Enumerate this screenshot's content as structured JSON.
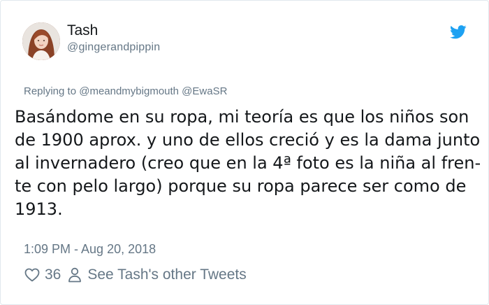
{
  "tweet": {
    "author_name": "Tash",
    "author_handle": "@gingerandpippin",
    "replying_prefix": "Replying to ",
    "replying_to": "@meandmybigmouth @EwaSR",
    "text": "Basándome en su ropa, mi teoría es que los niños son\nde 1900 aprox. y uno de ellos creció y es la dama junto\nal invernadero (creo que en la 4ª foto es la niña al fren-\nte con pelo largo) porque su ropa parece ser como de\n1913.",
    "timestamp": "1:09 PM - Aug 20, 2018",
    "likes_count": "36",
    "other_tweets_label": "See Tash's other Tweets"
  },
  "icons": {
    "brand": "twitter-bird-icon",
    "like": "heart-icon",
    "profile": "person-icon"
  },
  "colors": {
    "brand": "#1da1f2",
    "secondary_text": "#657786",
    "primary_text": "#14171a",
    "border": "#e1e8ed"
  }
}
